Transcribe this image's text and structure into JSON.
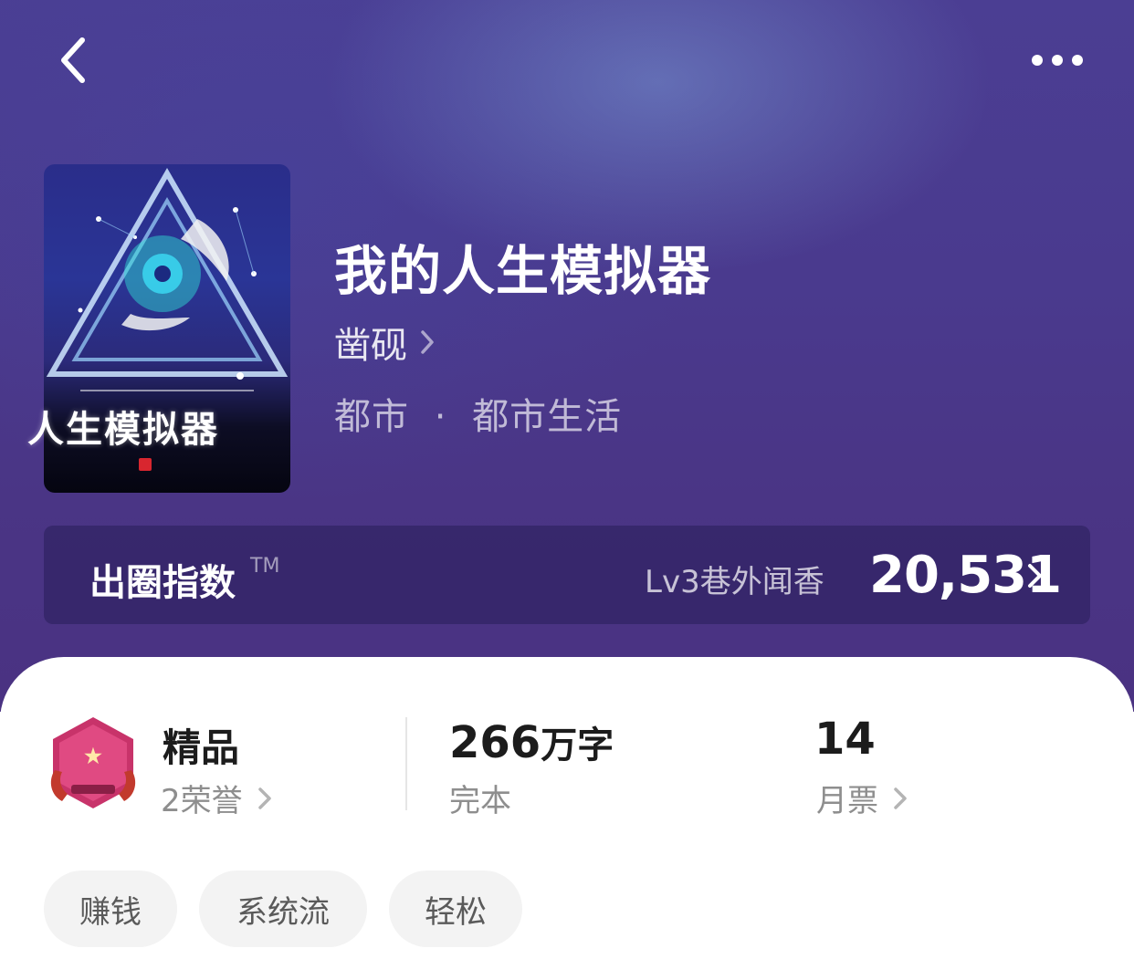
{
  "header": {
    "back_icon": "chevron-left-icon",
    "more_icon": "more-horizontal-icon"
  },
  "book": {
    "cover_title": "人生模拟器",
    "title": "我的人生模拟器",
    "author": "凿砚",
    "category": "都市",
    "separator": "·",
    "subcategory": "都市生活"
  },
  "influence": {
    "label": "出圈指数",
    "tm": "TM",
    "level": "Lv3巷外闻香",
    "score": "20,531"
  },
  "stats": {
    "tier": {
      "title": "精品",
      "honors": "2荣誉"
    },
    "words": {
      "count": "266",
      "unit": "万字",
      "status": "完本"
    },
    "votes": {
      "count": "14",
      "label": "月票"
    }
  },
  "tags": [
    "赚钱",
    "系统流",
    "轻松"
  ],
  "colors": {
    "hero_bg": "#4a3a8e",
    "badge": "#c8336a",
    "accent_text": "#1c1c1c"
  }
}
